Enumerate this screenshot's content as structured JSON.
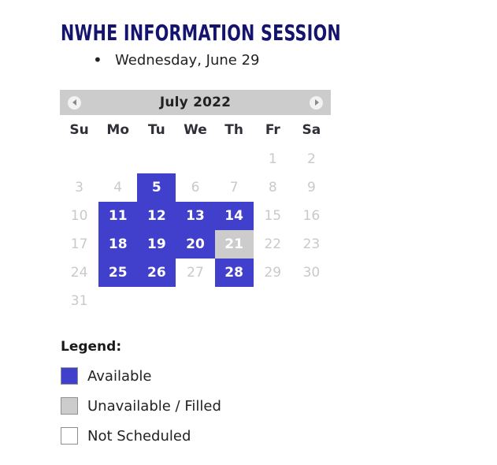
{
  "page": {
    "title": "NWHE INFORMATION SESSION",
    "title_color": "#14146e"
  },
  "info_list": {
    "items": [
      {
        "label": "Wednesday, June 29"
      }
    ]
  },
  "calendar": {
    "month_label": "July 2022",
    "prev_icon": "chevron-left-circle-icon",
    "next_icon": "chevron-right-circle-icon",
    "day_headers": [
      "Su",
      "Mo",
      "Tu",
      "We",
      "Th",
      "Fr",
      "Sa"
    ],
    "colors": {
      "available": "#4040cc",
      "filled": "#cccccc",
      "not_scheduled": "#ffffff",
      "header_bar": "#cccccc",
      "inactive_text": "#c9c9c9"
    },
    "weeks": [
      [
        {
          "label": "",
          "state": "empty"
        },
        {
          "label": "",
          "state": "empty"
        },
        {
          "label": "",
          "state": "empty"
        },
        {
          "label": "",
          "state": "empty"
        },
        {
          "label": "",
          "state": "empty"
        },
        {
          "label": "1",
          "state": "not-scheduled"
        },
        {
          "label": "2",
          "state": "not-scheduled"
        }
      ],
      [
        {
          "label": "3",
          "state": "not-scheduled"
        },
        {
          "label": "4",
          "state": "not-scheduled"
        },
        {
          "label": "5",
          "state": "available"
        },
        {
          "label": "6",
          "state": "not-scheduled"
        },
        {
          "label": "7",
          "state": "not-scheduled"
        },
        {
          "label": "8",
          "state": "not-scheduled"
        },
        {
          "label": "9",
          "state": "not-scheduled"
        }
      ],
      [
        {
          "label": "10",
          "state": "not-scheduled"
        },
        {
          "label": "11",
          "state": "available"
        },
        {
          "label": "12",
          "state": "available"
        },
        {
          "label": "13",
          "state": "available"
        },
        {
          "label": "14",
          "state": "available"
        },
        {
          "label": "15",
          "state": "not-scheduled"
        },
        {
          "label": "16",
          "state": "not-scheduled"
        }
      ],
      [
        {
          "label": "17",
          "state": "not-scheduled"
        },
        {
          "label": "18",
          "state": "available"
        },
        {
          "label": "19",
          "state": "available"
        },
        {
          "label": "20",
          "state": "available"
        },
        {
          "label": "21",
          "state": "filled"
        },
        {
          "label": "22",
          "state": "not-scheduled"
        },
        {
          "label": "23",
          "state": "not-scheduled"
        }
      ],
      [
        {
          "label": "24",
          "state": "not-scheduled"
        },
        {
          "label": "25",
          "state": "available"
        },
        {
          "label": "26",
          "state": "available"
        },
        {
          "label": "27",
          "state": "not-scheduled"
        },
        {
          "label": "28",
          "state": "available"
        },
        {
          "label": "29",
          "state": "not-scheduled"
        },
        {
          "label": "30",
          "state": "not-scheduled"
        }
      ],
      [
        {
          "label": "31",
          "state": "not-scheduled"
        },
        {
          "label": "",
          "state": "empty"
        },
        {
          "label": "",
          "state": "empty"
        },
        {
          "label": "",
          "state": "empty"
        },
        {
          "label": "",
          "state": "empty"
        },
        {
          "label": "",
          "state": "empty"
        },
        {
          "label": "",
          "state": "empty"
        }
      ]
    ]
  },
  "legend": {
    "title": "Legend:",
    "items": [
      {
        "label": "Available",
        "state": "available"
      },
      {
        "label": "Unavailable / Filled",
        "state": "filled"
      },
      {
        "label": "Not Scheduled",
        "state": "not-scheduled"
      }
    ]
  }
}
